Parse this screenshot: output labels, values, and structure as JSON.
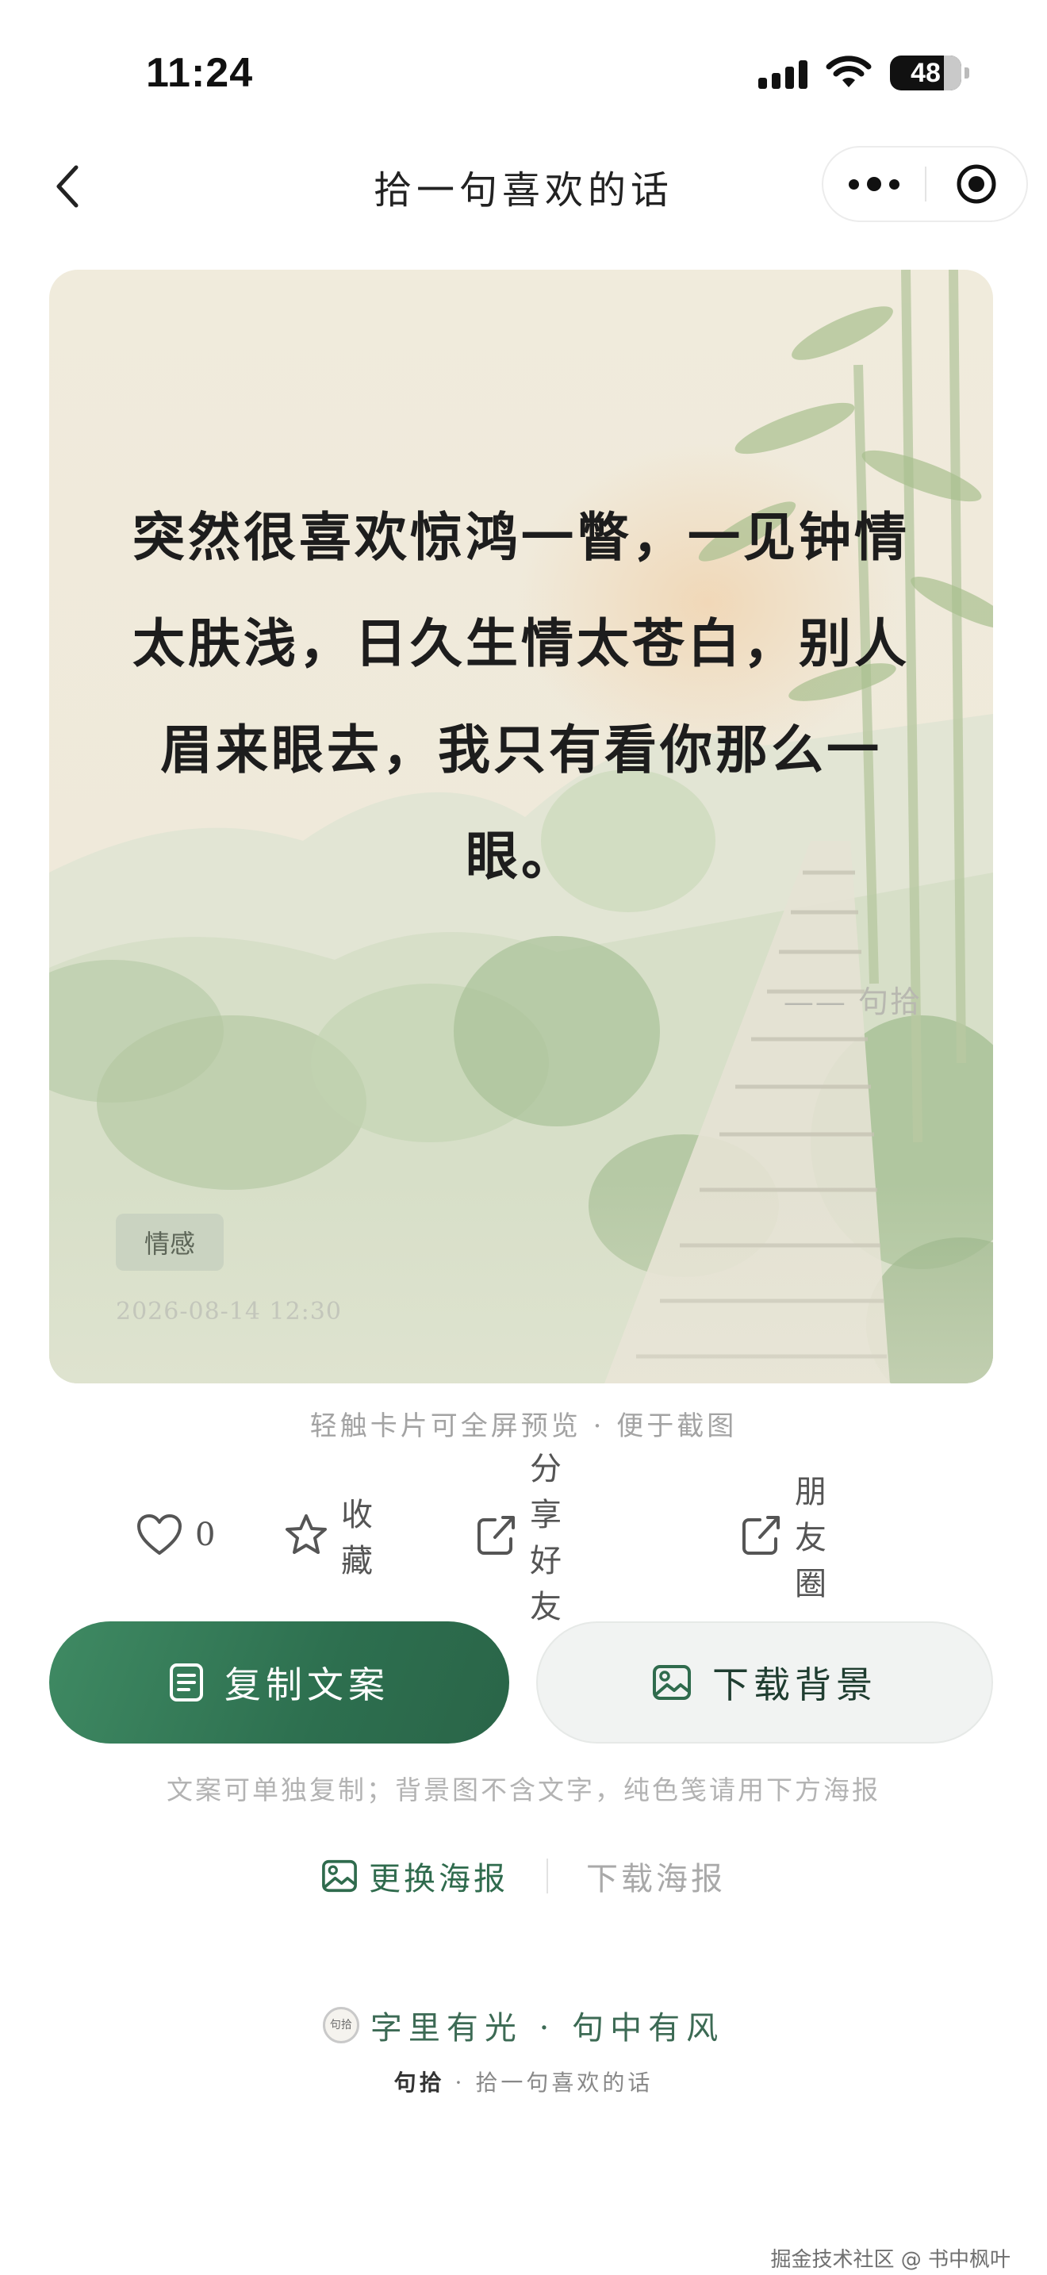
{
  "status_bar": {
    "time": "11:24",
    "battery": "48"
  },
  "nav": {
    "title": "拾一句喜欢的话"
  },
  "card": {
    "quote": "突然很喜欢惊鸿一瞥，一见钟情太肤浅，日久生情太苍白，别人眉来眼去，我只有看你那么一眼。",
    "signature": "—— 句拾",
    "tag": "情感",
    "date": "2026-08-14 12:30"
  },
  "hint": "轻触卡片可全屏预览 · 便于截图",
  "actions": {
    "like_count": "0",
    "favorite_label": "收藏",
    "share_friend_label": "分享好友",
    "moments_label": "朋友圈"
  },
  "buttons": {
    "copy_label": "复制文案",
    "download_bg_label": "下载背景"
  },
  "note": "文案可单独复制；背景图不含文字，纯色笺请用下方海报",
  "poster": {
    "change_label": "更换海报",
    "download_label": "下载海报"
  },
  "brand": {
    "seal_text": "句拾",
    "slogan": "字里有光 · 句中有风",
    "sub_name": "句拾",
    "sub_tagline": "· 拾一句喜欢的话"
  },
  "watermark": "掘金技术社区 @ 书中枫叶",
  "colors": {
    "accent": "#2f6b4d",
    "primary_button": "#2d6f4f",
    "secondary_button": "#f1f3f2"
  }
}
